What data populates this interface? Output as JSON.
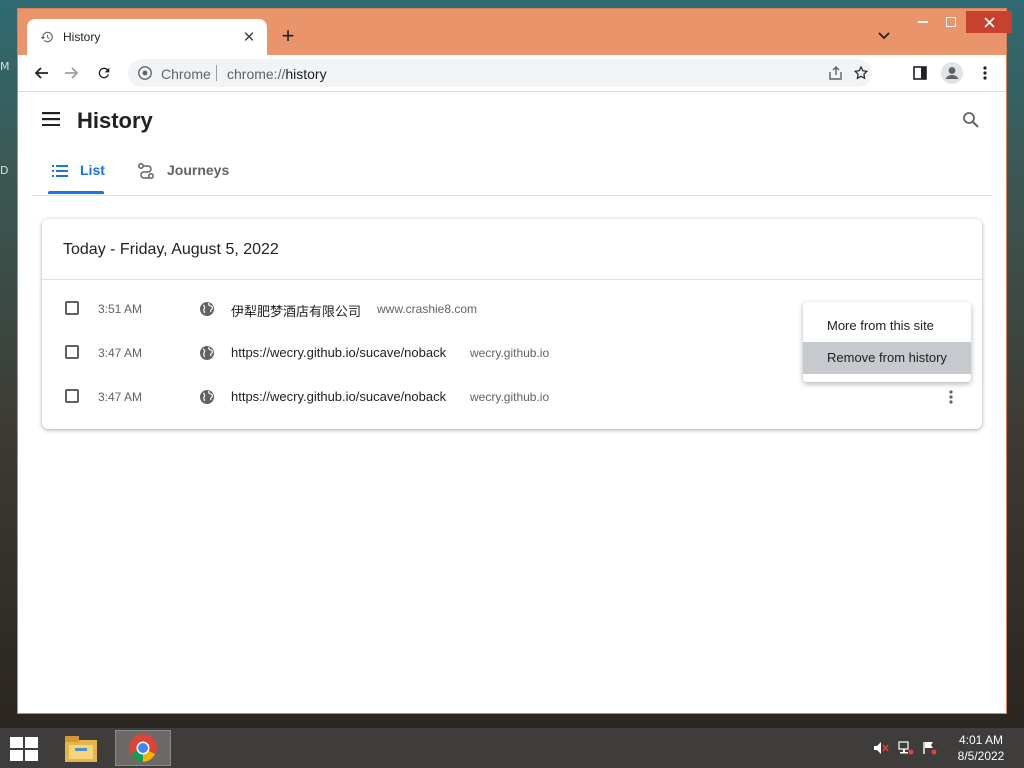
{
  "desktop": {
    "glyph_m": "M",
    "glyph_d": "D"
  },
  "browser": {
    "tab_title": "History",
    "new_tab_label": "+",
    "omnibox": {
      "site_label": "Chrome",
      "url_scheme": "chrome://",
      "url_path": "history"
    }
  },
  "page": {
    "title": "History",
    "tabs": [
      {
        "label": "List"
      },
      {
        "label": "Journeys"
      }
    ],
    "day_header": "Today - Friday, August 5, 2022",
    "rows": [
      {
        "time": "3:51 AM",
        "title": "伊犁肥梦酒店有限公司",
        "domain": "www.crashie8.com"
      },
      {
        "time": "3:47 AM",
        "title": "https://wecry.github.io/sucave/noback",
        "domain": "wecry.github.io"
      },
      {
        "time": "3:47 AM",
        "title": "https://wecry.github.io/sucave/noback",
        "domain": "wecry.github.io"
      }
    ],
    "context_menu": {
      "items": [
        {
          "label": "More from this site"
        },
        {
          "label": "Remove from history"
        }
      ]
    }
  },
  "taskbar": {
    "time": "4:01 AM",
    "date": "8/5/2022"
  },
  "colors": {
    "accent": "#1a73e8",
    "frame": "#e9946b",
    "close": "#c8402e"
  }
}
